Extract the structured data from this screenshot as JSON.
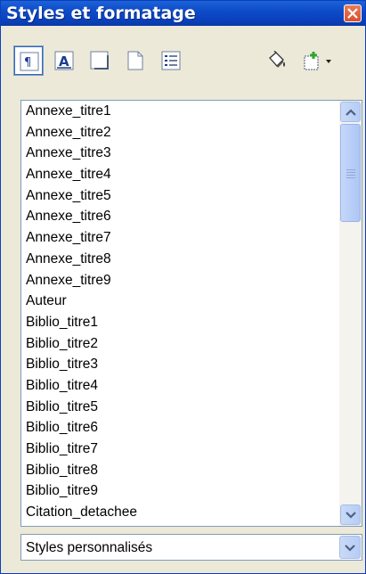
{
  "window": {
    "title": "Styles et formatage"
  },
  "toolbar": {
    "buttons": [
      {
        "name": "paragraph-styles",
        "icon": "paragraph-styles-icon",
        "active": true
      },
      {
        "name": "character-styles",
        "icon": "character-styles-icon",
        "active": false
      },
      {
        "name": "frame-styles",
        "icon": "frame-styles-icon",
        "active": false
      },
      {
        "name": "page-styles",
        "icon": "page-styles-icon",
        "active": false
      },
      {
        "name": "list-styles",
        "icon": "list-styles-icon",
        "active": false
      },
      {
        "name": "fill-format-mode",
        "icon": "paint-bucket-icon",
        "active": false
      },
      {
        "name": "new-style-from-selection",
        "icon": "new-style-icon",
        "active": false
      }
    ]
  },
  "styles_list": {
    "items": [
      "Annexe_titre1",
      "Annexe_titre2",
      "Annexe_titre3",
      "Annexe_titre4",
      "Annexe_titre5",
      "Annexe_titre6",
      "Annexe_titre7",
      "Annexe_titre8",
      "Annexe_titre9",
      "Auteur",
      "Biblio_titre1",
      "Biblio_titre2",
      "Biblio_titre3",
      "Biblio_titre4",
      "Biblio_titre5",
      "Biblio_titre6",
      "Biblio_titre7",
      "Biblio_titre8",
      "Biblio_titre9",
      "Citation_detachee"
    ]
  },
  "filter": {
    "selected": "Styles personnalisés"
  },
  "colors": {
    "titlebar": "#0a43c0",
    "accent": "#316ac5",
    "close": "#d9512d"
  }
}
